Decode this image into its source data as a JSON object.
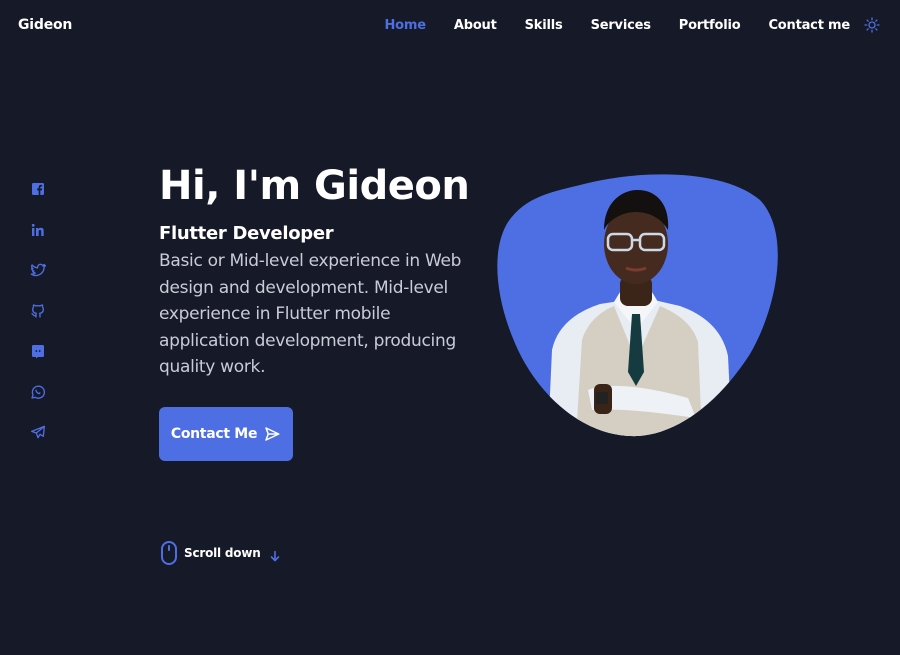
{
  "brand": {
    "name": "Gideon"
  },
  "nav": {
    "items": [
      {
        "label": "Home",
        "active": true
      },
      {
        "label": "About",
        "active": false
      },
      {
        "label": "Skills",
        "active": false
      },
      {
        "label": "Services",
        "active": false
      },
      {
        "label": "Portfolio",
        "active": false
      },
      {
        "label": "Contact me",
        "active": false
      }
    ],
    "theme_toggle_icon": "sun-icon"
  },
  "social": [
    "facebook-icon",
    "linkedin-icon",
    "twitter-icon",
    "github-icon",
    "discord-icon",
    "whatsapp-icon",
    "telegram-icon"
  ],
  "hero": {
    "title": "Hi, I'm Gideon",
    "subtitle": "Flutter Developer",
    "description": "Basic or Mid-level experience in Web design and development. Mid-level experience in Flutter mobile application development, producing quality work.",
    "button_label": "Contact Me",
    "button_icon": "send-icon"
  },
  "scroll": {
    "label": "Scroll down",
    "icon": "mouse-icon",
    "arrow_icon": "arrow-down-icon"
  },
  "colors": {
    "background": "#161928",
    "accent": "#4e6fe3",
    "text": "#ffffff",
    "muted_text": "#c9ccd6"
  }
}
